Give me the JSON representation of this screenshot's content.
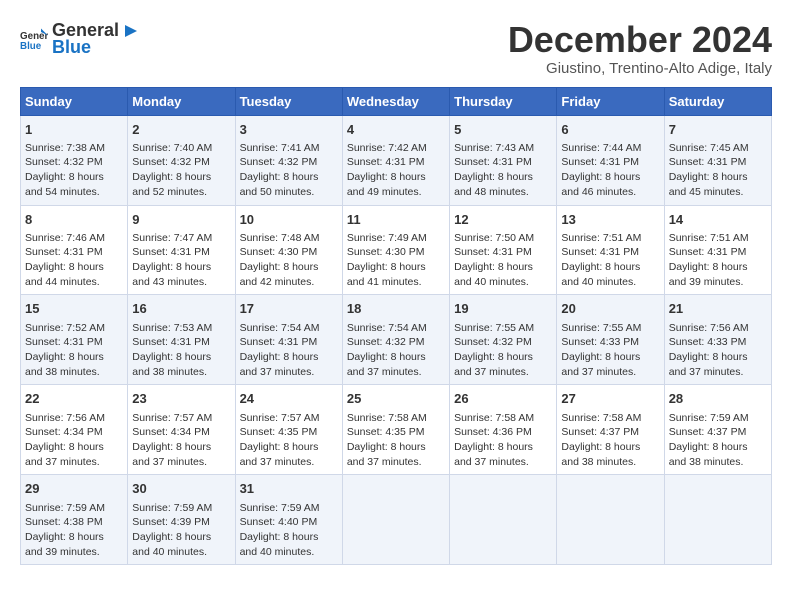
{
  "logo": {
    "line1": "General",
    "line2": "Blue"
  },
  "title": "December 2024",
  "location": "Giustino, Trentino-Alto Adige, Italy",
  "weekdays": [
    "Sunday",
    "Monday",
    "Tuesday",
    "Wednesday",
    "Thursday",
    "Friday",
    "Saturday"
  ],
  "weeks": [
    [
      {
        "day": "1",
        "sunrise": "7:38 AM",
        "sunset": "4:32 PM",
        "daylight": "8 hours and 54 minutes."
      },
      {
        "day": "2",
        "sunrise": "7:40 AM",
        "sunset": "4:32 PM",
        "daylight": "8 hours and 52 minutes."
      },
      {
        "day": "3",
        "sunrise": "7:41 AM",
        "sunset": "4:32 PM",
        "daylight": "8 hours and 50 minutes."
      },
      {
        "day": "4",
        "sunrise": "7:42 AM",
        "sunset": "4:31 PM",
        "daylight": "8 hours and 49 minutes."
      },
      {
        "day": "5",
        "sunrise": "7:43 AM",
        "sunset": "4:31 PM",
        "daylight": "8 hours and 48 minutes."
      },
      {
        "day": "6",
        "sunrise": "7:44 AM",
        "sunset": "4:31 PM",
        "daylight": "8 hours and 46 minutes."
      },
      {
        "day": "7",
        "sunrise": "7:45 AM",
        "sunset": "4:31 PM",
        "daylight": "8 hours and 45 minutes."
      }
    ],
    [
      {
        "day": "8",
        "sunrise": "7:46 AM",
        "sunset": "4:31 PM",
        "daylight": "8 hours and 44 minutes."
      },
      {
        "day": "9",
        "sunrise": "7:47 AM",
        "sunset": "4:31 PM",
        "daylight": "8 hours and 43 minutes."
      },
      {
        "day": "10",
        "sunrise": "7:48 AM",
        "sunset": "4:30 PM",
        "daylight": "8 hours and 42 minutes."
      },
      {
        "day": "11",
        "sunrise": "7:49 AM",
        "sunset": "4:30 PM",
        "daylight": "8 hours and 41 minutes."
      },
      {
        "day": "12",
        "sunrise": "7:50 AM",
        "sunset": "4:31 PM",
        "daylight": "8 hours and 40 minutes."
      },
      {
        "day": "13",
        "sunrise": "7:51 AM",
        "sunset": "4:31 PM",
        "daylight": "8 hours and 40 minutes."
      },
      {
        "day": "14",
        "sunrise": "7:51 AM",
        "sunset": "4:31 PM",
        "daylight": "8 hours and 39 minutes."
      }
    ],
    [
      {
        "day": "15",
        "sunrise": "7:52 AM",
        "sunset": "4:31 PM",
        "daylight": "8 hours and 38 minutes."
      },
      {
        "day": "16",
        "sunrise": "7:53 AM",
        "sunset": "4:31 PM",
        "daylight": "8 hours and 38 minutes."
      },
      {
        "day": "17",
        "sunrise": "7:54 AM",
        "sunset": "4:31 PM",
        "daylight": "8 hours and 37 minutes."
      },
      {
        "day": "18",
        "sunrise": "7:54 AM",
        "sunset": "4:32 PM",
        "daylight": "8 hours and 37 minutes."
      },
      {
        "day": "19",
        "sunrise": "7:55 AM",
        "sunset": "4:32 PM",
        "daylight": "8 hours and 37 minutes."
      },
      {
        "day": "20",
        "sunrise": "7:55 AM",
        "sunset": "4:33 PM",
        "daylight": "8 hours and 37 minutes."
      },
      {
        "day": "21",
        "sunrise": "7:56 AM",
        "sunset": "4:33 PM",
        "daylight": "8 hours and 37 minutes."
      }
    ],
    [
      {
        "day": "22",
        "sunrise": "7:56 AM",
        "sunset": "4:34 PM",
        "daylight": "8 hours and 37 minutes."
      },
      {
        "day": "23",
        "sunrise": "7:57 AM",
        "sunset": "4:34 PM",
        "daylight": "8 hours and 37 minutes."
      },
      {
        "day": "24",
        "sunrise": "7:57 AM",
        "sunset": "4:35 PM",
        "daylight": "8 hours and 37 minutes."
      },
      {
        "day": "25",
        "sunrise": "7:58 AM",
        "sunset": "4:35 PM",
        "daylight": "8 hours and 37 minutes."
      },
      {
        "day": "26",
        "sunrise": "7:58 AM",
        "sunset": "4:36 PM",
        "daylight": "8 hours and 37 minutes."
      },
      {
        "day": "27",
        "sunrise": "7:58 AM",
        "sunset": "4:37 PM",
        "daylight": "8 hours and 38 minutes."
      },
      {
        "day": "28",
        "sunrise": "7:59 AM",
        "sunset": "4:37 PM",
        "daylight": "8 hours and 38 minutes."
      }
    ],
    [
      {
        "day": "29",
        "sunrise": "7:59 AM",
        "sunset": "4:38 PM",
        "daylight": "8 hours and 39 minutes."
      },
      {
        "day": "30",
        "sunrise": "7:59 AM",
        "sunset": "4:39 PM",
        "daylight": "8 hours and 40 minutes."
      },
      {
        "day": "31",
        "sunrise": "7:59 AM",
        "sunset": "4:40 PM",
        "daylight": "8 hours and 40 minutes."
      },
      null,
      null,
      null,
      null
    ]
  ],
  "labels": {
    "sunrise": "Sunrise:",
    "sunset": "Sunset:",
    "daylight": "Daylight:"
  }
}
